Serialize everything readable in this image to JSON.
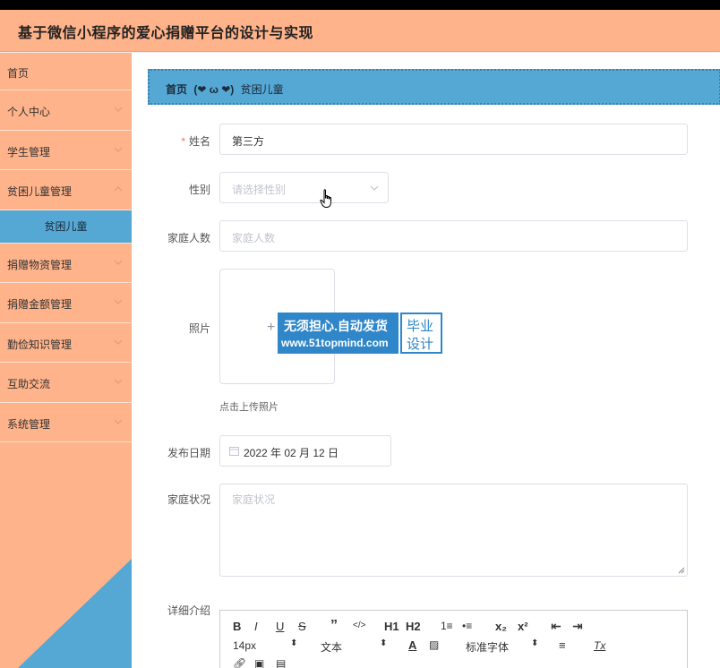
{
  "app": {
    "title": "基于微信小程序的爱心捐赠平台的设计与实现"
  },
  "sidebar": {
    "items": [
      {
        "label": "首页",
        "expandable": false
      },
      {
        "label": "个人中心",
        "expandable": true
      },
      {
        "label": "学生管理",
        "expandable": true
      },
      {
        "label": "贫困儿童管理",
        "expandable": true
      }
    ],
    "active_sub": "贫困儿童",
    "items_after": [
      {
        "label": "捐赠物资管理",
        "expandable": true
      },
      {
        "label": "捐赠金额管理",
        "expandable": true
      },
      {
        "label": "勤俭知识管理",
        "expandable": true
      },
      {
        "label": "互助交流",
        "expandable": true
      },
      {
        "label": "系统管理",
        "expandable": true
      }
    ]
  },
  "breadcrumb": {
    "home": "首页",
    "separator": "(❤ ω ❤)",
    "current": "贫困儿童"
  },
  "form": {
    "name": {
      "label": "姓名",
      "required": "*",
      "value": "第三方"
    },
    "gender": {
      "label": "性别",
      "placeholder": "请选择性别"
    },
    "family_size": {
      "label": "家庭人数",
      "placeholder": "家庭人数"
    },
    "photo": {
      "label": "照片",
      "plus": "+",
      "tip": "点击上传照片"
    },
    "publish_date": {
      "label": "发布日期",
      "value": "2022 年 02 月 12 日"
    },
    "family_status": {
      "label": "家庭状况",
      "placeholder": "家庭状况"
    },
    "details": {
      "label": "详细介绍"
    }
  },
  "editor_toolbar": {
    "row1": [
      "B",
      "I",
      "U",
      "S",
      "”",
      "</>",
      "H1",
      "H2",
      "1≡",
      "•≡",
      "x₂",
      "x²",
      "⇤",
      "⇥"
    ],
    "font_size": "14px",
    "block": "文本",
    "color": "A",
    "font_family": "标准字体",
    "align": "≡",
    "clear": "Tx"
  },
  "watermark": {
    "line1": "无须担心.自动发货",
    "line2": "www.51topmind.com",
    "box_line1": "毕业",
    "box_line2": "设计"
  },
  "colors": {
    "header": "#ffb38a",
    "sidebar": "#ffb38a",
    "accent": "#56a8d4",
    "required": "#f56c6c"
  }
}
